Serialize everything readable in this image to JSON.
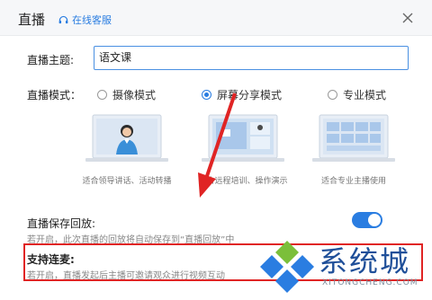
{
  "window": {
    "title": "直播",
    "cs_link": "在线客服",
    "close_icon": "close-icon"
  },
  "topic": {
    "label": "直播主题:",
    "value": "语文课"
  },
  "mode": {
    "label": "直播模式：",
    "options": [
      {
        "label": "摄像模式",
        "caption": "适合领导讲话、活动转播",
        "selected": false
      },
      {
        "label": "屏幕分享模式",
        "caption": "适合远程培训、操作演示",
        "selected": true
      },
      {
        "label": "专业模式",
        "caption": "适合专业主播使用",
        "selected": false
      }
    ]
  },
  "save_replay": {
    "label": "直播保存回放:",
    "desc": "若开启，此次直播的回放将自动保存到“直播回放”中",
    "enabled": true
  },
  "mic": {
    "label": "支持连麦:",
    "desc": "若开启，直播发起后主播可邀请观众进行视频互动"
  },
  "colors": {
    "accent": "#2a7de1",
    "highlight": "#e02424"
  },
  "watermark": {
    "text": "系统城",
    "url": "XITONGCHENG.COM"
  }
}
